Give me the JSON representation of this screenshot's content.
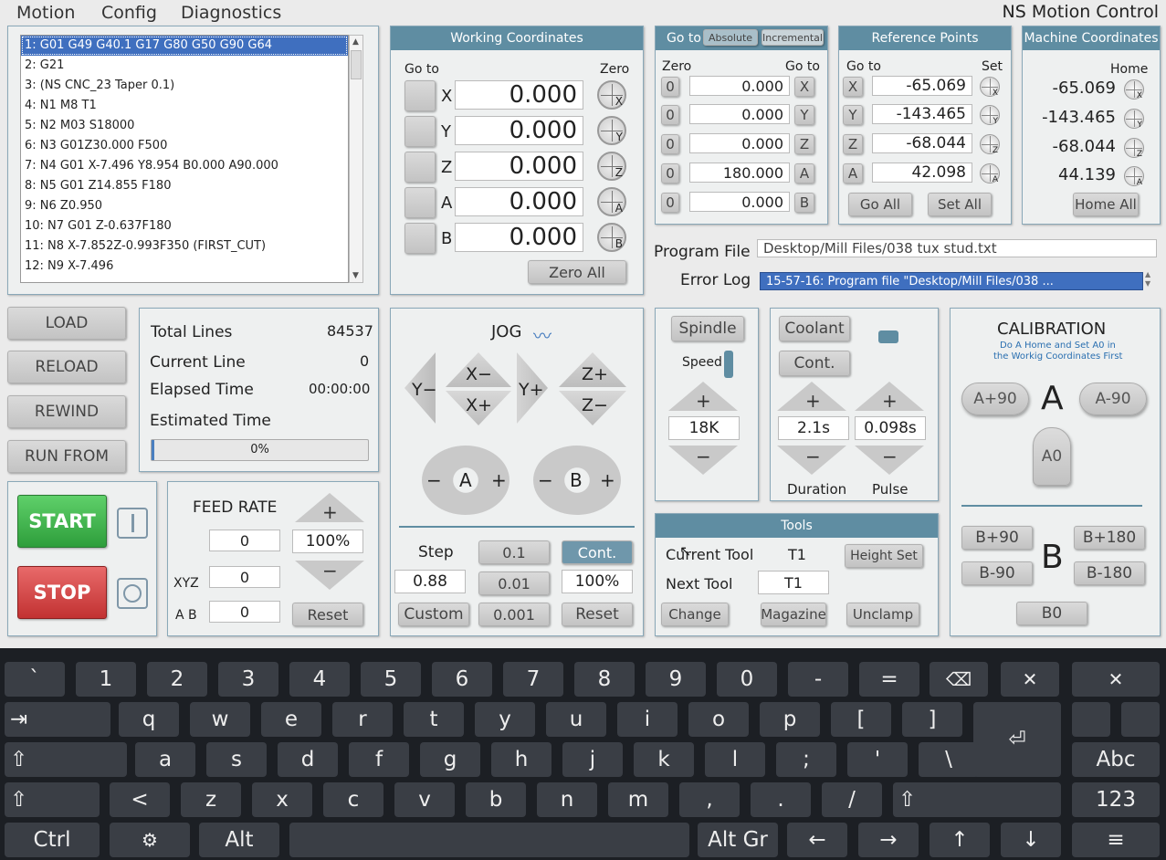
{
  "menu": {
    "motion": "Motion",
    "config": "Config",
    "diagnostics": "Diagnostics"
  },
  "app_title": "NS Motion Control",
  "gcode_lines": [
    "1: G01 G49 G40.1 G17 G80 G50 G90 G64",
    "2: G21",
    "3: (NS CNC_23 Taper 0.1)",
    "4: N1 M8 T1",
    "5: N2 M03 S18000",
    "6: N3 G01Z30.000 F500",
    "7: N4 G01 X-7.496 Y8.954 B0.000 A90.000",
    "8: N5 G01 Z14.855 F180",
    "9: N6 Z0.950",
    "10: N7 G01 Z-0.637F180",
    "11: N8 X-7.852Z-0.993F350 (FIRST_CUT)",
    "12: N9 X-7.496"
  ],
  "working": {
    "title": "Working Coordinates",
    "goto": "Go to",
    "zero": "Zero",
    "axes": [
      "X",
      "Y",
      "Z",
      "A",
      "B"
    ],
    "values": [
      "0.000",
      "0.000",
      "0.000",
      "0.000",
      "0.000"
    ],
    "zero_all": "Zero All"
  },
  "goto_panel": {
    "title": "Go to",
    "absolute": "Absolute",
    "incremental": "Incremental",
    "zero": "Zero",
    "goto": "Go to",
    "zeros": [
      "0",
      "0",
      "0",
      "0",
      "0"
    ],
    "values": [
      "0.000",
      "0.000",
      "0.000",
      "180.000",
      "0.000"
    ],
    "axes": [
      "X",
      "Y",
      "Z",
      "A",
      "B"
    ]
  },
  "reference": {
    "title": "Reference Points",
    "goto": "Go to",
    "set": "Set",
    "axes": [
      "X",
      "Y",
      "Z",
      "A"
    ],
    "values": [
      "-65.069",
      "-143.465",
      "-68.044",
      "42.098"
    ],
    "go_all": "Go All",
    "set_all": "Set All"
  },
  "machine": {
    "title": "Machine Coordinates",
    "home": "Home",
    "values": [
      "-65.069",
      "-143.465",
      "-68.044",
      "44.139"
    ],
    "axes": [
      "X",
      "Y",
      "Z",
      "A"
    ],
    "home_all": "Home All"
  },
  "program_file": {
    "label": "Program File",
    "value": "Desktop/Mill Files/038 tux stud.txt"
  },
  "error_log": {
    "label": "Error Log",
    "value": "15-57-16: Program file \"Desktop/Mill Files/038 ..."
  },
  "file_buttons": {
    "load": "LOAD",
    "reload": "RELOAD",
    "rewind": "REWIND",
    "run_from": "RUN FROM"
  },
  "stats": {
    "total_lines_label": "Total Lines",
    "total_lines": "84537",
    "current_line_label": "Current Line",
    "current_line": "0",
    "elapsed_label": "Elapsed Time",
    "elapsed": "00:00:00",
    "estimated_label": "Estimated Time",
    "progress_text": "0%",
    "progress": 0.0
  },
  "control": {
    "start": "START",
    "stop": "STOP"
  },
  "feed": {
    "title": "FEED RATE",
    "plus": "+",
    "minus": "−",
    "f1": "0",
    "f2": "0",
    "f3": "0",
    "percent": "100%",
    "xyz": "XYZ",
    "ab": "A B",
    "reset": "Reset"
  },
  "jog": {
    "title": "JOG",
    "y_minus": "Y−",
    "y_plus": "Y+",
    "x_minus": "X−",
    "x_plus": "X+",
    "z_plus": "Z+",
    "z_minus": "Z−",
    "a": "A",
    "b": "B",
    "minus": "−",
    "plus": "+",
    "step": "Step",
    "step_value": "0.88",
    "s1": "0.1",
    "s2": "0.01",
    "s3": "0.001",
    "cont": "Cont.",
    "percent": "100%",
    "custom": "Custom",
    "reset": "Reset"
  },
  "spindle": {
    "label": "Spindle",
    "speed": "Speed",
    "plus": "+",
    "minus": "−",
    "value": "18K"
  },
  "coolant": {
    "label": "Coolant",
    "cont": "Cont.",
    "duration_value": "2.1s",
    "pulse_value": "0.098s",
    "duration": "Duration",
    "pulse": "Pulse",
    "plus": "+",
    "minus": "−"
  },
  "tools": {
    "title": "Tools",
    "current_label": "Current Tool",
    "current": "T1",
    "next_label": "Next Tool",
    "next": "T1",
    "height_set": "Height Set",
    "change": "Change",
    "magazine": "Magazine",
    "unclamp": "Unclamp"
  },
  "calibration": {
    "title": "CALIBRATION",
    "sub1": "Do A Home and Set A0 in",
    "sub2": "the Workig Coordinates First",
    "a_plus": "A+90",
    "a_minus": "A-90",
    "a": "A",
    "a0": "A0",
    "b_plus90": "B+90",
    "b_plus180": "B+180",
    "b_minus90": "B-90",
    "b_minus180": "B-180",
    "b": "B",
    "b0": "B0"
  },
  "keyboard": {
    "row1": [
      "`",
      "1",
      "2",
      "3",
      "4",
      "5",
      "6",
      "7",
      "8",
      "9",
      "0",
      "-",
      "="
    ],
    "row2": [
      "q",
      "w",
      "e",
      "r",
      "t",
      "y",
      "u",
      "i",
      "o",
      "p",
      "[",
      "]"
    ],
    "row3": [
      "a",
      "s",
      "d",
      "f",
      "g",
      "h",
      "j",
      "k",
      "l",
      ";",
      "'",
      "\\"
    ],
    "row4": [
      "<",
      "z",
      "x",
      "c",
      "v",
      "b",
      "n",
      "m",
      ",",
      ".",
      "/"
    ],
    "ctrl": "Ctrl",
    "alt": "Alt",
    "altgr": "Alt Gr",
    "abc": "Abc",
    "num": "123",
    "left": "←",
    "right": "→",
    "up": "↑",
    "down": "↓",
    "menu": "≡",
    "tab": "⇥",
    "shift": "⇧",
    "backspace": "⌫",
    "close": "✕",
    "enter": "⏎",
    "super": "⚙"
  }
}
